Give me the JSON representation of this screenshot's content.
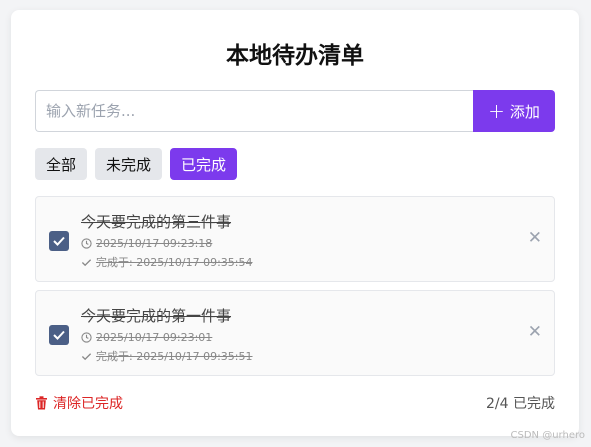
{
  "app": {
    "title": "本地待办清单"
  },
  "input": {
    "placeholder": "输入新任务...",
    "value": ""
  },
  "add_button": {
    "label": "添加",
    "icon": "plus-icon"
  },
  "filters": [
    {
      "label": "全部",
      "active": false
    },
    {
      "label": "未完成",
      "active": false
    },
    {
      "label": "已完成",
      "active": true
    }
  ],
  "todos": [
    {
      "text": "今天要完成的第三件事",
      "created": "2025/10/17 09:23:18",
      "completed": "完成于: 2025/10/17 09:35:54",
      "done": true
    },
    {
      "text": "今天要完成的第一件事",
      "created": "2025/10/17 09:23:01",
      "completed": "完成于: 2025/10/17 09:35:51",
      "done": true
    }
  ],
  "footer": {
    "clear_label": "清除已完成",
    "count_label": "2/4 已完成"
  },
  "watermark": "CSDN @urhero",
  "colors": {
    "accent": "#7c3aed",
    "checkbox": "#4b5f86",
    "danger": "#dc2626"
  }
}
